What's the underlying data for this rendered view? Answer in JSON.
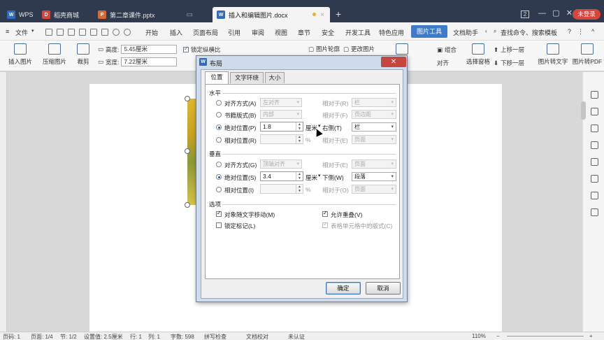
{
  "titlebar": {
    "tabs": [
      {
        "label": "WPS",
        "icon": "wps-logo-icon"
      },
      {
        "label": "稻壳商城",
        "icon": "docer-icon"
      },
      {
        "label": "第二章课件.pptx",
        "icon": "ppt-icon"
      },
      {
        "label": "插入和编辑图片.docx",
        "icon": "word-icon"
      }
    ],
    "window_count": "2",
    "login_label": "未登录"
  },
  "menubar": {
    "file_label": "文件",
    "items": [
      "开始",
      "插入",
      "页面布局",
      "引用",
      "审阅",
      "视图",
      "章节",
      "安全",
      "开发工具",
      "特色应用",
      "图片工具",
      "文档助手"
    ],
    "active": "图片工具",
    "search_label": "查找命令、搜索模板"
  },
  "ribbon": {
    "insert_picture": "插入图片",
    "compress_picture": "压缩图片",
    "crop": "裁剪",
    "height_label": "高度:",
    "height_value": "5.45厘米",
    "width_label": "宽度:",
    "width_value": "7.22厘米",
    "lock_ratio": "锁定纵横比",
    "picture_outline": "图片轮廓",
    "change_picture": "更改图片",
    "rotate": "旋转",
    "align": "对齐",
    "group": "组合",
    "selection_pane": "选择窗格",
    "bring_forward": "上移一层",
    "send_backward": "下移一层",
    "pic_to_text": "图片转文字",
    "pic_to_pdf": "图片转PDF"
  },
  "statusbar": {
    "page_no": "页码: 1",
    "pages": "页面: 1/4",
    "section": "节: 1/2",
    "setting": "设置值: 2.5厘米",
    "row": "行: 1",
    "col": "列: 1",
    "words": "字数: 598",
    "spell": "拼写检查",
    "proof": "文档校对",
    "auth": "未认证",
    "zoom": "110%"
  },
  "dialog": {
    "title": "布局",
    "tabs": [
      "位置",
      "文字环绕",
      "大小"
    ],
    "active_tab": "位置",
    "horizontal": {
      "section_label": "水平",
      "align_label": "对齐方式(A)",
      "align_value": "左对齐",
      "align_rel_label": "相对于(R)",
      "align_rel_value": "栏",
      "book_label": "书籍版式(B)",
      "book_value": "内部",
      "book_rel_label": "相对于(F)",
      "book_rel_value": "页边距",
      "abs_label": "绝对位置(P)",
      "abs_value": "1.8",
      "abs_unit": "厘米",
      "abs_rel_label": "右侧(T)",
      "abs_rel_value": "栏",
      "rel_label": "相对位置(R)",
      "rel_unit": "%",
      "rel_rel_label": "相对于(E)",
      "rel_rel_value": "页面"
    },
    "vertical": {
      "section_label": "垂直",
      "align_label": "对齐方式(G)",
      "align_value": "顶端对齐",
      "align_rel_label": "相对于(E)",
      "align_rel_value": "页面",
      "abs_label": "绝对位置(S)",
      "abs_value": "3.4",
      "abs_unit": "厘米",
      "abs_rel_label": "下侧(W)",
      "abs_rel_value": "段落",
      "rel_label": "相对位置(I)",
      "rel_unit": "%",
      "rel_rel_label": "相对于(O)",
      "rel_rel_value": "页面"
    },
    "options": {
      "section_label": "选项",
      "move_with_text": "对象随文字移动(M)",
      "allow_overlap": "允许重叠(V)",
      "lock_anchor": "锁定标记(L)",
      "table_cell_layout": "表格单元格中的版式(C)"
    },
    "ok_label": "确定",
    "cancel_label": "取消"
  },
  "colors": {
    "titlebar_bg": "#2f3a4e",
    "accent": "#3e7bc9",
    "login_red": "#d9453b"
  }
}
